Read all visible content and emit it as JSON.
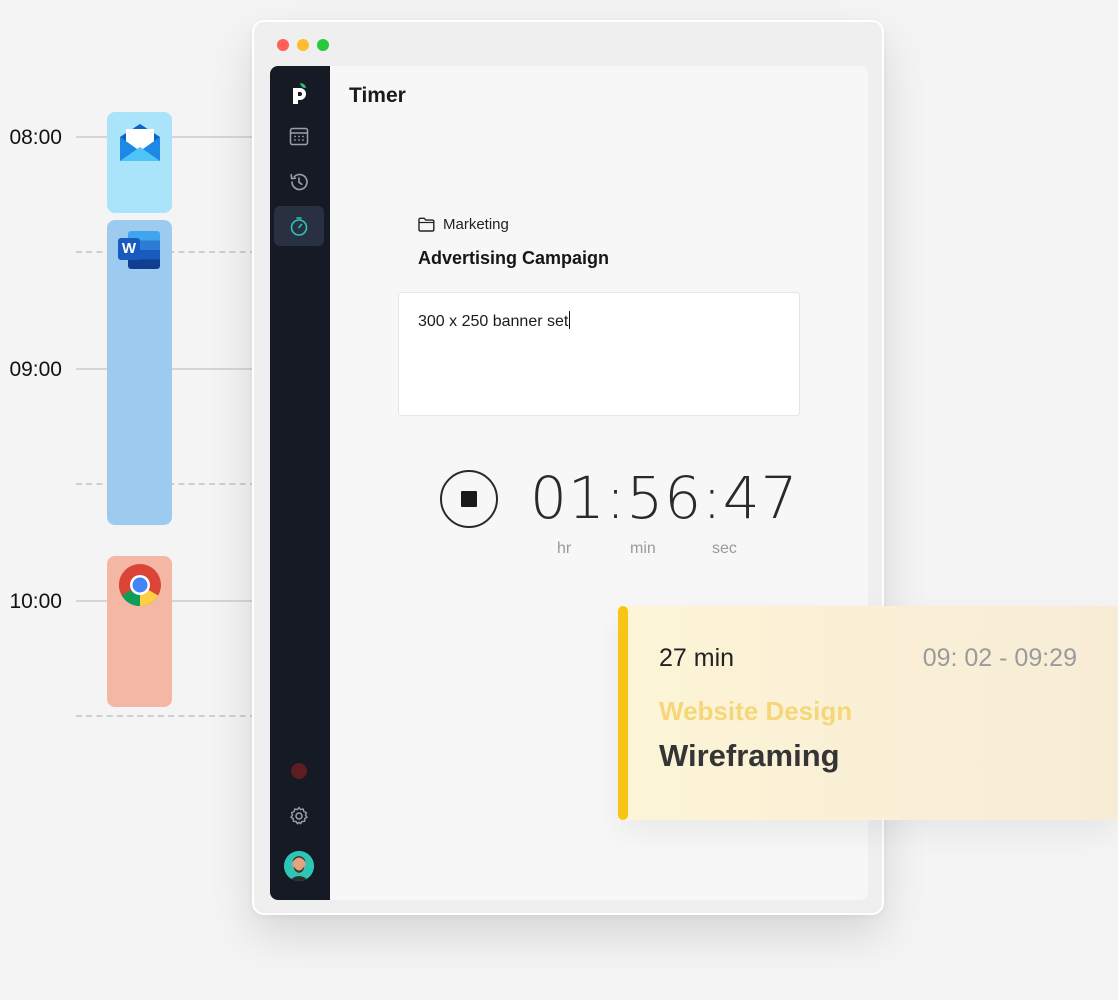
{
  "timeline": {
    "times": [
      "08:00",
      "09:00",
      "10:00"
    ],
    "apps": [
      {
        "name": "mail-icon"
      },
      {
        "name": "word-icon",
        "letter": "W"
      },
      {
        "name": "chrome-icon"
      }
    ]
  },
  "window": {
    "title": "Timer",
    "sidebar": {
      "items": [
        "logo-icon",
        "calendar-icon",
        "history-icon",
        "timer-icon",
        "record-indicator",
        "gear-icon",
        "avatar"
      ],
      "active": "timer-icon"
    },
    "project": "Marketing",
    "task": "Advertising Campaign",
    "description": "300 x 250 banner set",
    "timer": {
      "display": "01:56:47",
      "units": [
        "hr",
        "min",
        "sec"
      ]
    }
  },
  "card": {
    "duration": "27 min",
    "range": "09: 02 - 09:29",
    "project": "Website Design",
    "task": "Wireframing"
  },
  "colors": {
    "sidebar": "#161a24",
    "accent_teal": "#2ec4b6",
    "card_bar": "#f7c614",
    "card_project": "#f5d77a",
    "mail_block": "#a9e4fb",
    "word_block": "#9ccbef",
    "chrome_block": "#f3b7a4"
  }
}
